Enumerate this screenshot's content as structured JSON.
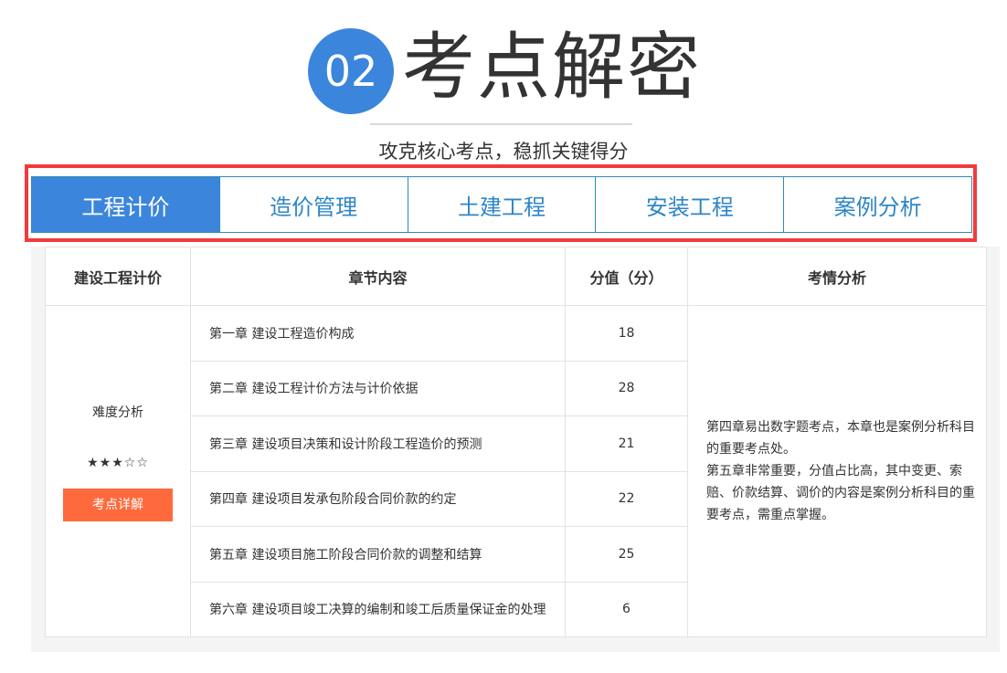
{
  "header": {
    "number": "02",
    "title": "考点解密",
    "subtitle": "攻克核心考点，稳抓关键得分"
  },
  "tabs": [
    {
      "label": "工程计价",
      "active": true
    },
    {
      "label": "造价管理",
      "active": false
    },
    {
      "label": "土建工程",
      "active": false
    },
    {
      "label": "安装工程",
      "active": false
    },
    {
      "label": "案例分析",
      "active": false
    }
  ],
  "table": {
    "headers": [
      "建设工程计价",
      "章节内容",
      "分值（分）",
      "考情分析"
    ],
    "difficulty_label": "难度分析",
    "difficulty_stars": "★★★☆☆",
    "detail_button": "考点详解",
    "rows": [
      {
        "chapter": "第一章 建设工程造价构成",
        "score": "18"
      },
      {
        "chapter": "第二章 建设工程计价方法与计价依据",
        "score": "28"
      },
      {
        "chapter": "第三章 建设项目决策和设计阶段工程造价的预测",
        "score": "21"
      },
      {
        "chapter": "第四章 建设项目发承包阶段合同价款的约定",
        "score": "22"
      },
      {
        "chapter": "第五章 建设项目施工阶段合同价款的调整和结算",
        "score": "25"
      },
      {
        "chapter": "第六章 建设项目竣工决算的编制和竣工后质量保证金的处理",
        "score": "6"
      }
    ],
    "analysis_p1": "第四章易出数字题考点，本章也是案例分析科目的重要考点处。",
    "analysis_p2": "第五章非常重要，分值占比高，其中变更、索赔、价款结算、调价的内容是案例分析科目的重要考点，需重点掌握。"
  },
  "colors": {
    "accent_blue": "#3b86dc",
    "highlight_red": "#f23a3a",
    "button_orange": "#ff6a3d"
  }
}
